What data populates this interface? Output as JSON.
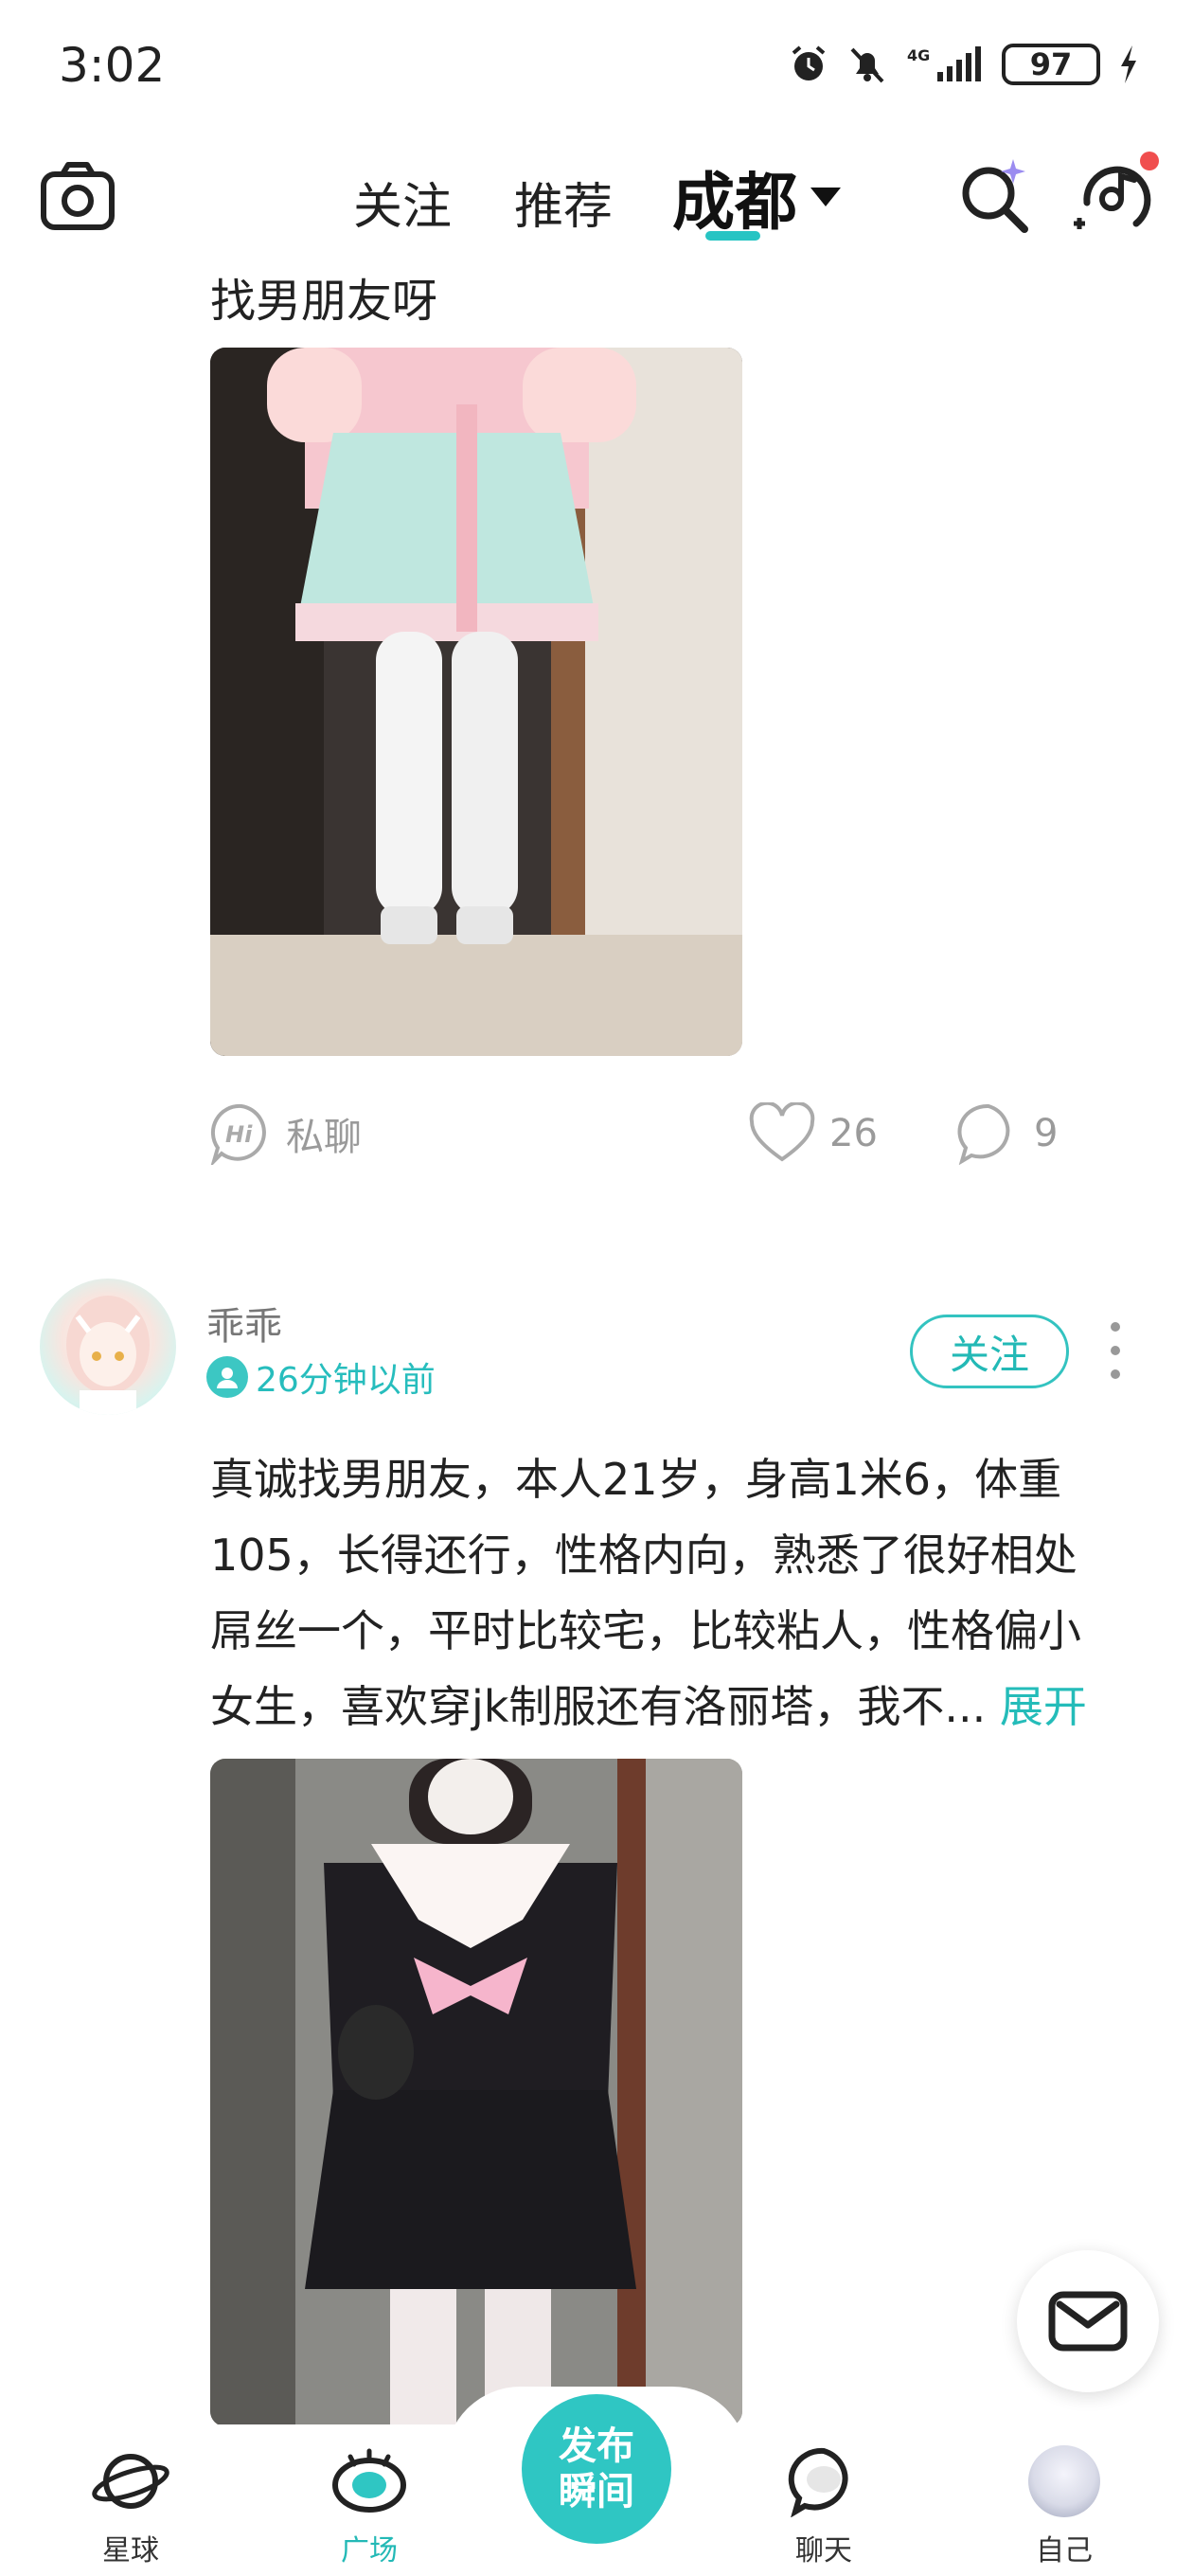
{
  "status_bar": {
    "time": "3:02",
    "network": "4G",
    "battery": "97",
    "icons": [
      "alarm-icon",
      "bell-mute-icon",
      "signal-icon",
      "battery-icon",
      "charging-icon"
    ]
  },
  "top_nav": {
    "tabs": [
      {
        "label": "关注"
      },
      {
        "label": "推荐"
      },
      {
        "label": "成都",
        "active": true
      }
    ],
    "accent_color": "#27c4c3",
    "notification_dot_color": "#f04e4e"
  },
  "posts": [
    {
      "text": "找男朋友呀",
      "actions": {
        "chat_label": "私聊",
        "likes": "26",
        "comments": "9"
      }
    },
    {
      "author": "乖乖",
      "time": "26分钟以前",
      "follow_label": "关注",
      "text_lines": [
        "真诚找男朋友，本人21岁，身高1米6，体重",
        "105，长得还行，性格内向，熟悉了很好相处",
        "屌丝一个，平时比较宅，比较粘人，性格偏小",
        "女生，喜欢穿jk制服还有洛丽塔，我不..."
      ],
      "expand_label": "展开"
    }
  ],
  "bottom_nav": {
    "items": [
      {
        "label": "星球"
      },
      {
        "label": "广场",
        "active": true
      },
      {
        "label": "聊天"
      },
      {
        "label": "自己"
      }
    ],
    "publish_label_1": "发布",
    "publish_label_2": "瞬间"
  }
}
